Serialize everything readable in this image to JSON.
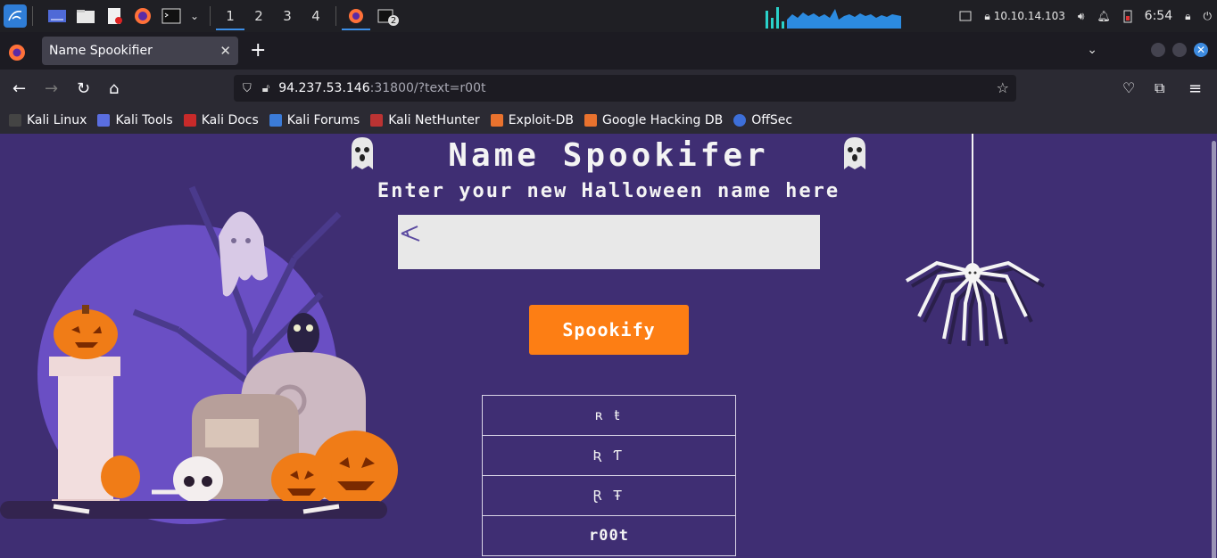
{
  "taskbar": {
    "workspaces": [
      "1",
      "2",
      "3",
      "4"
    ],
    "active_workspace": "1",
    "terminal_badge": "2",
    "ip": "10.10.14.103",
    "clock": "6:54"
  },
  "browser": {
    "tab_title": "Name Spookifier",
    "url_host": "94.237.53.146",
    "url_rest": ":31800/?text=r00t",
    "bookmarks": [
      "Kali Linux",
      "Kali Tools",
      "Kali Docs",
      "Kali Forums",
      "Kali NetHunter",
      "Exploit-DB",
      "Google Hacking DB",
      "OffSec"
    ]
  },
  "page": {
    "title": "Name Spookifer",
    "subtitle": "Enter your new Halloween name here",
    "input_value": "",
    "button_label": "Spookify",
    "results": [
      "ʀ ŧ",
      "Ʀ Ƭ",
      "Ɽ Ŧ",
      "r00t"
    ]
  },
  "colors": {
    "page_bg": "#3f2e73",
    "button": "#fd7e14",
    "accent": "#3c8ee6"
  }
}
